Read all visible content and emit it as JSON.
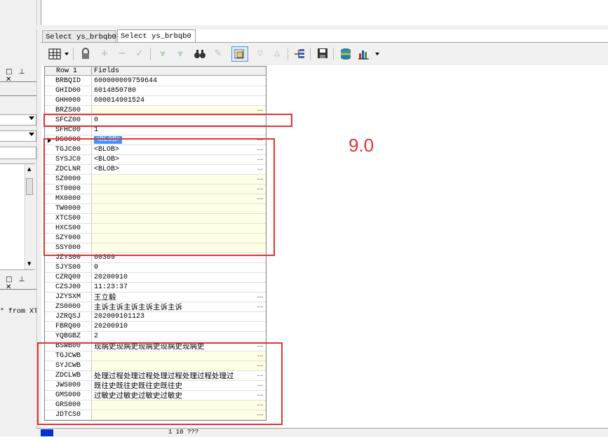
{
  "left_panel": {
    "pane_buttons": "□ ⊥ ✕",
    "text_fragment": "* from XT"
  },
  "tabs": [
    {
      "label": "Select ys_brbqb0"
    },
    {
      "label": "Select ys_brbqb0"
    }
  ],
  "toolbar": {
    "icons": [
      "grid-view-icon",
      "lock-icon",
      "insert-row-icon",
      "delete-row-icon",
      "apply-icon",
      "first-icon",
      "last-icon",
      "find-icon",
      "clear-icon",
      "filter-icon",
      "sort-asc-icon",
      "sort-desc-icon",
      "tree-icon",
      "save-icon",
      "database-icon",
      "chart-icon"
    ]
  },
  "grid": {
    "header_row": "Row 1",
    "header_fields": "Fields",
    "rows": [
      {
        "name": "BRBQID",
        "value": "600000009759644"
      },
      {
        "name": "GHID00",
        "value": "6014850780"
      },
      {
        "name": "GHH000",
        "value": "600014901524"
      },
      {
        "name": "BRZS00",
        "value": ""
      },
      {
        "name": "SFCZ00",
        "value": "0"
      },
      {
        "name": "SFHC00",
        "value": "1"
      },
      {
        "name": "DS0000",
        "value": "<BLOB>"
      },
      {
        "name": "TGJC00",
        "value": "<BLOB>"
      },
      {
        "name": "SYSJC0",
        "value": "<BLOB>"
      },
      {
        "name": "ZDCLNR",
        "value": "<BLOB>"
      },
      {
        "name": "SZ0000",
        "value": ""
      },
      {
        "name": "ST0000",
        "value": ""
      },
      {
        "name": "MX0000",
        "value": ""
      },
      {
        "name": "TW0000",
        "value": ""
      },
      {
        "name": "XTCS00",
        "value": ""
      },
      {
        "name": "HXCS00",
        "value": ""
      },
      {
        "name": "SZY000",
        "value": ""
      },
      {
        "name": "SSY000",
        "value": ""
      },
      {
        "name": "JZYS00",
        "value": "60369"
      },
      {
        "name": "SJYS00",
        "value": "0"
      },
      {
        "name": "CZRQ00",
        "value": "20200910"
      },
      {
        "name": "CZSJ00",
        "value": "11:23:37"
      },
      {
        "name": "JZYSXM",
        "value": "王立毅"
      },
      {
        "name": "ZS0000",
        "value": "主诉主诉主诉主诉主诉主诉"
      },
      {
        "name": "JZRQSJ",
        "value": "202009101123"
      },
      {
        "name": "FBRQ00",
        "value": "20200910"
      },
      {
        "name": "YQBGBZ",
        "value": "2"
      },
      {
        "name": "BSWB00",
        "value": "现病史现病史现病史现病史现病史"
      },
      {
        "name": "TGJCWB",
        "value": ""
      },
      {
        "name": "SYJCWB",
        "value": ""
      },
      {
        "name": "ZDCLWB",
        "value": "处理过程处理过程处理过程处理过程处理过"
      },
      {
        "name": "JWS000",
        "value": "既往史既往史既往史既往史"
      },
      {
        "name": "GMS000",
        "value": "过敏史过敏史过敏史过敏史"
      },
      {
        "name": "GRS000",
        "value": ""
      },
      {
        "name": "JDTCS0",
        "value": ""
      }
    ]
  },
  "annotation": {
    "label": "9.0",
    "color": "#e53333"
  },
  "statusbar": {
    "text": "1 10 ??? "
  }
}
